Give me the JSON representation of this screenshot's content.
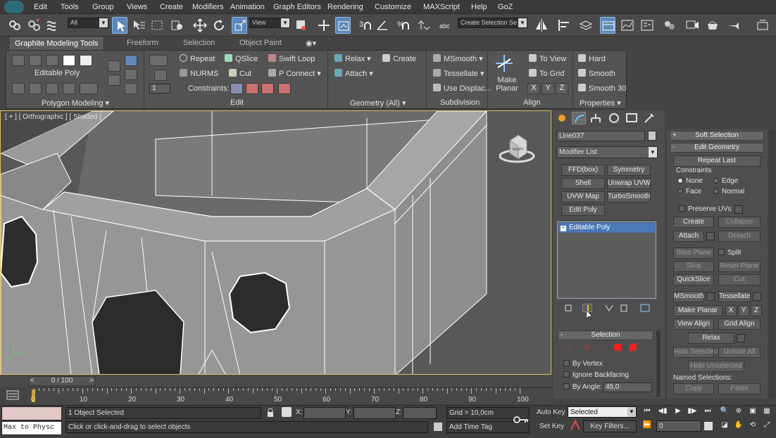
{
  "menu": [
    "Edit",
    "Tools",
    "Group",
    "Views",
    "Create",
    "Modifiers",
    "Animation",
    "Graph Editors",
    "Rendering",
    "Customize",
    "MAXScript",
    "Help",
    "GoZ"
  ],
  "toolbar": {
    "selection_filter": "All",
    "ref_coord": "View",
    "named_selection": "Create Selection Se"
  },
  "ribbon": {
    "tabs": [
      "Graphite Modeling Tools",
      "Freeform",
      "Selection",
      "Object Paint"
    ],
    "polygon_modeling": {
      "object_type": "Editable Poly",
      "panel_label": "Polygon Modeling"
    },
    "edit": {
      "repeat": "Repeat",
      "qslice": "QSlice",
      "swift_loop": "Swift Loop",
      "nurms": "NURMS",
      "cut": "Cut",
      "p_connect": "P Connect",
      "constraints": "Constraints:",
      "spinner_value": "1",
      "panel_label": "Edit"
    },
    "geometry": {
      "relax": "Relax",
      "create": "Create",
      "attach": "Attach",
      "panel_label": "Geometry (All)"
    },
    "subdivision": {
      "msmooth": "MSmooth",
      "tessellate": "Tessellate",
      "use_displace": "Use Displac...",
      "panel_label": "Subdivision"
    },
    "align": {
      "make_planar": "Make Planar",
      "to_view": "To View",
      "to_grid": "To Grid",
      "x": "X",
      "y": "Y",
      "z": "Z",
      "panel_label": "Align"
    },
    "properties": {
      "hard": "Hard",
      "smooth": "Smooth",
      "smooth30": "Smooth 30",
      "panel_label": "Properties"
    }
  },
  "viewport": {
    "label": "[ + ] [ Orthographic ] [ Shaded ]",
    "viewcube_face": "RIGHT"
  },
  "command_panel": {
    "object_name": "Line037",
    "modifier_list": "Modifier List",
    "modifier_buttons": [
      "FFD(box)",
      "Symmetry",
      "Shell",
      "Unwrap UVW",
      "UVW Map",
      "TurboSmooth",
      "Edit Poly"
    ],
    "stack_item": "Editable Poly",
    "selection": {
      "title": "Selection",
      "by_vertex": "By Vertex",
      "ignore_backfacing": "Ignore Backfacing",
      "by_angle": "By Angle:",
      "angle_value": "45,0"
    }
  },
  "edit_geometry": {
    "soft_selection": "Soft Selection",
    "title": "Edit Geometry",
    "repeat_last": "Repeat Last",
    "constraints": "Constraints",
    "none": "None",
    "edge": "Edge",
    "face": "Face",
    "normal": "Normal",
    "preserve_uvs": "Preserve UVs",
    "create": "Create",
    "collapse": "Collapse",
    "attach": "Attach",
    "detach": "Detach",
    "slice_plane": "Slice Plane",
    "split": "Split",
    "slice": "Slice",
    "reset_plane": "Reset Plane",
    "quickslice": "QuickSlice",
    "cut": "Cut",
    "msmooth": "MSmooth",
    "tessellate": "Tessellate",
    "make_planar": "Make Planar",
    "x": "X",
    "y": "Y",
    "z": "Z",
    "view_align": "View Align",
    "grid_align": "Grid Align",
    "relax": "Relax",
    "hide_selected": "Hide Selected",
    "unhide_all": "Unhide All",
    "hide_unselected": "Hide Unselected",
    "named_selections": "Named Selections:",
    "copy": "Copy",
    "paste": "Paste"
  },
  "timeline": {
    "slider": "0 / 100",
    "ticks": [
      "0",
      "10",
      "20",
      "30",
      "40",
      "50",
      "60",
      "70",
      "80",
      "90",
      "100"
    ]
  },
  "status": {
    "script_listener": "Max to Physc",
    "selected_count": "1 Object Selected",
    "prompt": "Click or click-and-drag to select objects",
    "x_label": "X:",
    "y_label": "Y:",
    "z_label": "Z:",
    "grid": "Grid = 10,0cm",
    "add_time_tag": "Add Time Tag",
    "auto_key": "Auto Key",
    "set_key": "Set Key",
    "key_mode": "Selected",
    "key_filters": "Key Filters...",
    "frame": "0"
  }
}
